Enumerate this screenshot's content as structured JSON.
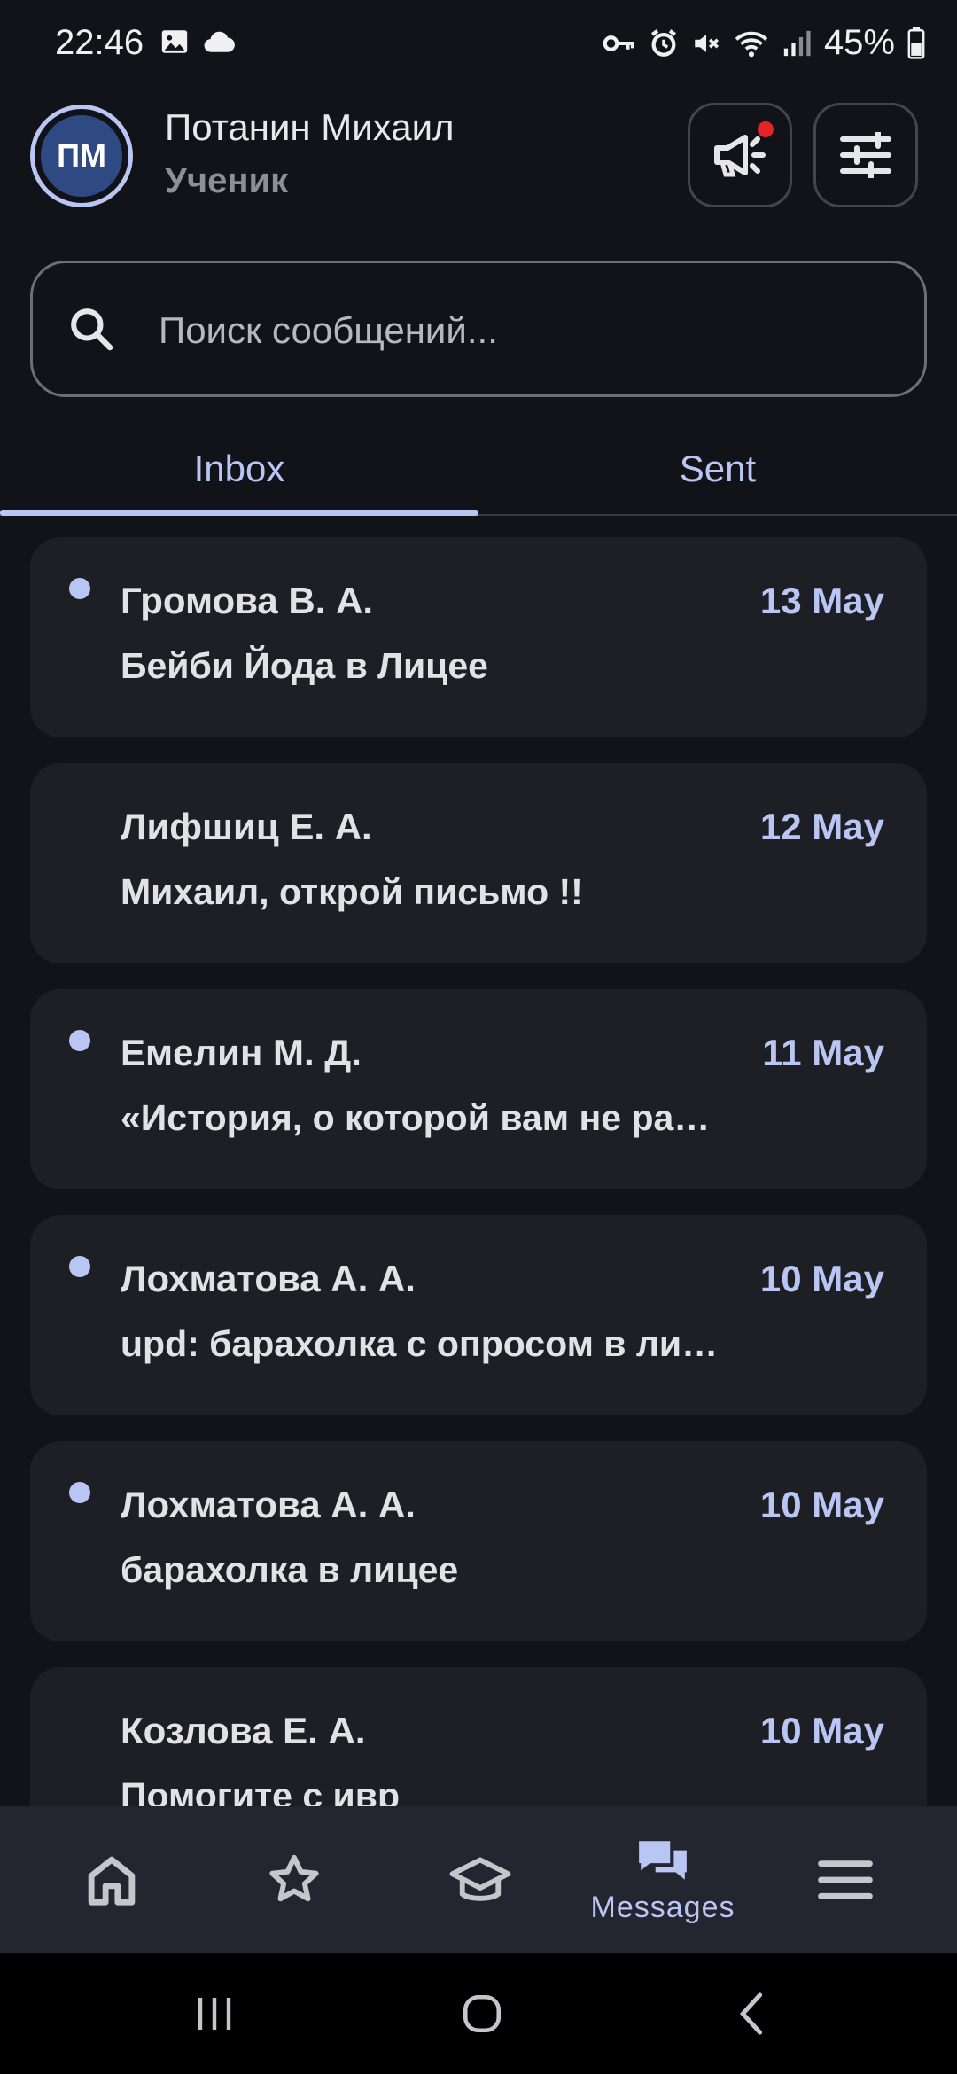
{
  "status_bar": {
    "time": "22:46",
    "battery": "45%",
    "icons": [
      "image-icon",
      "cloud-icon",
      "key-icon",
      "alarm-icon",
      "mute-icon",
      "wifi-icon",
      "signal-icon",
      "battery-icon"
    ]
  },
  "header": {
    "avatar_initials": "ПМ",
    "user_name": "Потанин Михаил",
    "user_role": "Ученик",
    "announce_has_notification": true
  },
  "search": {
    "placeholder": "Поиск сообщений..."
  },
  "tabs": [
    {
      "label": "Inbox",
      "active": true
    },
    {
      "label": "Sent",
      "active": false
    }
  ],
  "messages": [
    {
      "sender": "Громова В. А.",
      "date": "13 May",
      "subject": "Бейби Йода в Лицее",
      "unread": true
    },
    {
      "sender": "Лифшиц Е. А.",
      "date": "12 May",
      "subject": "Михаил, открой письмо !!",
      "unread": false
    },
    {
      "sender": "Емелин М. Д.",
      "date": "11 May",
      "subject": "«История, о которой вам не ра…",
      "unread": true
    },
    {
      "sender": "Лохматова А. А.",
      "date": "10 May",
      "subject": "upd: барахолка с опросом в ли…",
      "unread": true
    },
    {
      "sender": "Лохматова А. А.",
      "date": "10 May",
      "subject": "барахолка в лицее",
      "unread": true
    },
    {
      "sender": "Козлова Е. А.",
      "date": "10 May",
      "subject": "Помогите с ивр",
      "unread": false
    }
  ],
  "bottom_nav": {
    "items": [
      {
        "icon": "home-icon",
        "label": ""
      },
      {
        "icon": "star-icon",
        "label": ""
      },
      {
        "icon": "graduation-cap-icon",
        "label": ""
      },
      {
        "icon": "messages-icon",
        "label": "Messages",
        "active": true
      },
      {
        "icon": "menu-icon",
        "label": ""
      }
    ]
  },
  "colors": {
    "background": "#121318",
    "card": "#1e1f25",
    "accent": "#b9c6f4",
    "notification": "#e5232b"
  }
}
